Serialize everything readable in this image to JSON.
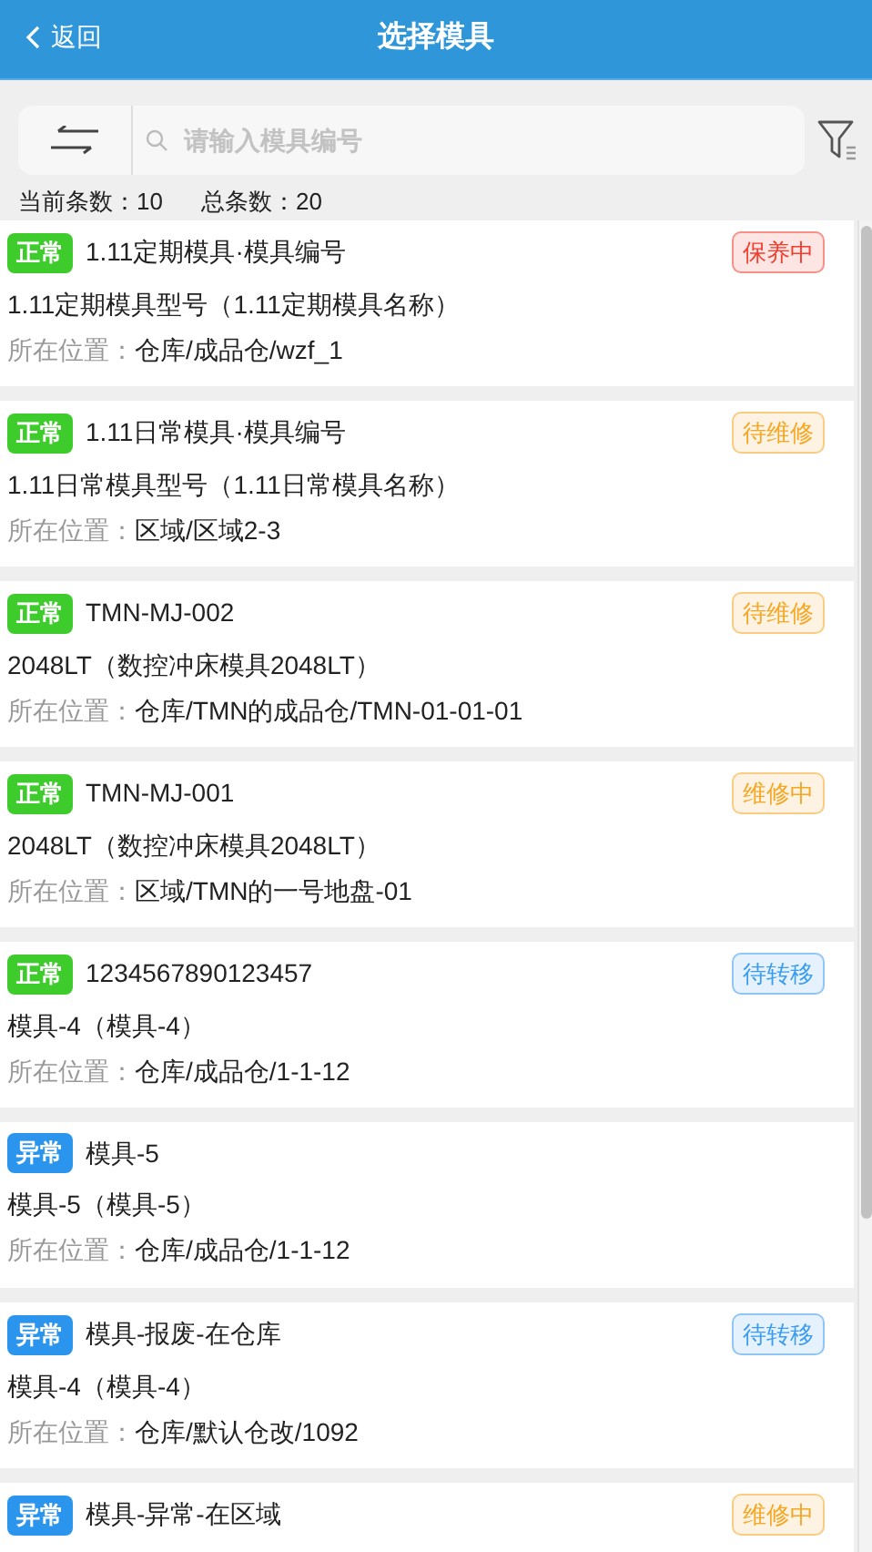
{
  "header": {
    "back": "返回",
    "title": "选择模具"
  },
  "search": {
    "placeholder": "请输入模具编号"
  },
  "counts": [
    {
      "label": "当前条数：",
      "value": "10"
    },
    {
      "label": "总条数：",
      "value": "20"
    }
  ],
  "items": [
    {
      "condition": {
        "text": "正常",
        "color": "#3dcc2b"
      },
      "code": "1.11定期模具·模具编号",
      "status": {
        "text": "保养中",
        "color": "#f23c2c"
      },
      "model": "1.11定期模具型号（1.11定期模具名称）",
      "location_label": "所在位置：",
      "location": "仓库/成品仓/wzf_1"
    },
    {
      "condition": {
        "text": "正常",
        "color": "#3dcc2b"
      },
      "code": "1.11日常模具·模具编号",
      "status": {
        "text": "待维修",
        "color": "#f5a623"
      },
      "model": "1.11日常模具型号（1.11日常模具名称）",
      "location_label": "所在位置：",
      "location": "区域/区域2-3"
    },
    {
      "condition": {
        "text": "正常",
        "color": "#3dcc2b"
      },
      "code": "TMN-MJ-002",
      "status": {
        "text": "待维修",
        "color": "#f5a623"
      },
      "model": "2048LT（数控冲床模具2048LT）",
      "location_label": "所在位置：",
      "location": "仓库/TMN的成品仓/TMN-01-01-01"
    },
    {
      "condition": {
        "text": "正常",
        "color": "#3dcc2b"
      },
      "code": "TMN-MJ-001",
      "status": {
        "text": "维修中",
        "color": "#f5a623"
      },
      "model": "2048LT（数控冲床模具2048LT）",
      "location_label": "所在位置：",
      "location": "区域/TMN的一号地盘-01"
    },
    {
      "condition": {
        "text": "正常",
        "color": "#3dcc2b"
      },
      "code": "1234567890123457",
      "status": {
        "text": "待转移",
        "color": "#3a9cf0"
      },
      "model": "模具-4（模具-4）",
      "location_label": "所在位置：",
      "location": "仓库/成品仓/1-1-12"
    },
    {
      "condition": {
        "text": "异常",
        "color": "#2b95ee"
      },
      "code": "模具-5",
      "model": "模具-5（模具-5）",
      "location_label": "所在位置：",
      "location": "仓库/成品仓/1-1-12"
    },
    {
      "condition": {
        "text": "异常",
        "color": "#2b95ee"
      },
      "code": "模具-报废-在仓库",
      "status": {
        "text": "待转移",
        "color": "#3a9cf0"
      },
      "model": "模具-4（模具-4）",
      "location_label": "所在位置：",
      "location": "仓库/默认仓改/1092"
    },
    {
      "condition": {
        "text": "异常",
        "color": "#2b95ee"
      },
      "code": "模具-异常-在区域",
      "status": {
        "text": "维修中",
        "color": "#f5a623"
      }
    }
  ]
}
